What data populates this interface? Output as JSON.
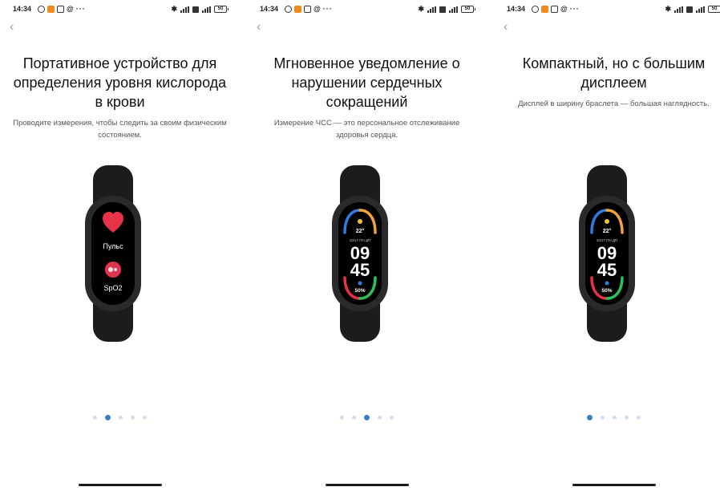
{
  "screens": [
    {
      "status": {
        "time": "14:34",
        "battery": "50"
      },
      "title": "Портативное устройство для определения уровня кислорода в крови",
      "subtitle": "Проводите измерения, чтобы следить за своим физическим состоянием.",
      "watch": {
        "type": "health",
        "pulse_label": "Пульс",
        "spo2_label": "SpO2"
      },
      "pager": {
        "count": 5,
        "active": 1
      }
    },
    {
      "status": {
        "time": "14:34",
        "battery": "50"
      },
      "title": "Мгновенное уведомление о нарушении сердечных сокращений",
      "subtitle": "Измерение ЧСС — это персональное отслеживание здоровья сердца.",
      "watch": {
        "type": "clock",
        "temp": "22°",
        "date": "10/17 ПН ДП",
        "hours": "09",
        "minutes": "45",
        "percent": "50%"
      },
      "pager": {
        "count": 5,
        "active": 2
      }
    },
    {
      "status": {
        "time": "14:34",
        "battery": "50"
      },
      "title": "Компактный, но с большим дисплеем",
      "subtitle": "Дисплей в ширину браслета — большая наглядность.",
      "watch": {
        "type": "clock",
        "temp": "22°",
        "date": "10/17 ПН ДП",
        "hours": "09",
        "minutes": "45",
        "percent": "50%"
      },
      "pager": {
        "count": 5,
        "active": 0
      }
    }
  ],
  "colors": {
    "accent": "#3c7fc9",
    "dot_inactive": "#cfe0f2",
    "heart": "#e8324a",
    "spo2": "#e0344f"
  }
}
